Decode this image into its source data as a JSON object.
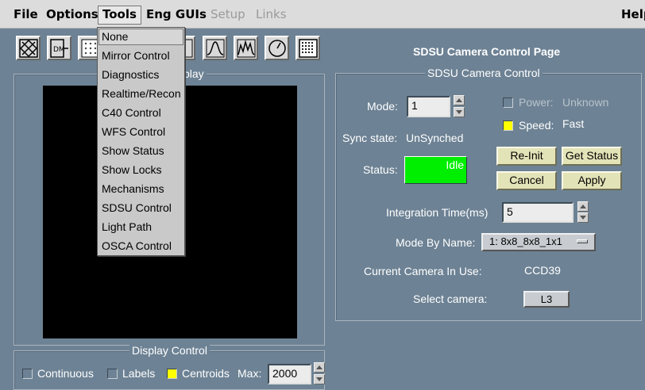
{
  "menubar": {
    "file": "File",
    "options": "Options",
    "tools": "Tools",
    "eng_guis": "Eng GUIs",
    "setup": "Setup",
    "links": "Links",
    "help": "Help"
  },
  "toolbar": {
    "icons": [
      "mirror-x-icon",
      "dm-icon",
      "grid-dots-icon",
      "blank-icon",
      "peak-curve-icon",
      "spectrum-icon",
      "dial-icon",
      "dot-grid-icon"
    ]
  },
  "tools_menu": {
    "items": [
      "None",
      "Mirror Control",
      "Diagnostics",
      "Realtime/Recon",
      "C40 Control",
      "WFS Control",
      "Show Status",
      "Show Locks",
      "Mechanisms",
      "SDSU Control",
      "Light Path",
      "OSCA Control"
    ]
  },
  "left_frame": {
    "title_fragment": "play"
  },
  "display_control": {
    "title": "Display Control",
    "continuous": "Continuous",
    "continuous_checked": false,
    "labels": "Labels",
    "labels_checked": false,
    "centroids": "Centroids",
    "centroids_checked": true,
    "max_label": "Max:",
    "max_value": "2000"
  },
  "page": {
    "title": "SDSU Camera Control Page"
  },
  "camera_control": {
    "title": "SDSU Camera Control",
    "mode_label": "Mode:",
    "mode_value": "1",
    "power_label": "Power:",
    "power_value": "Unknown",
    "power_checked": false,
    "speed_label": "Speed:",
    "speed_value": "Fast",
    "speed_checked": true,
    "sync_label": "Sync state:",
    "sync_value": "UnSynched",
    "status_label": "Status:",
    "status_value": "Idle",
    "status_color": "#00ee00",
    "reinit_button": "Re-Init",
    "get_status_button": "Get Status",
    "cancel_button": "Cancel",
    "apply_button": "Apply",
    "integration_label": "Integration Time(ms)",
    "integration_value": "5",
    "mode_by_name_label": "Mode By Name:",
    "mode_by_name_value": "1: 8x8_8x8_1x1",
    "current_camera_label": "Current Camera In Use:",
    "current_camera_value": "CCD39",
    "select_camera_label": "Select camera:",
    "select_camera_value": "L3"
  },
  "colors": {
    "background": "#6d8294",
    "button_face": "#e3e3b8",
    "checked": "#ffff00"
  }
}
